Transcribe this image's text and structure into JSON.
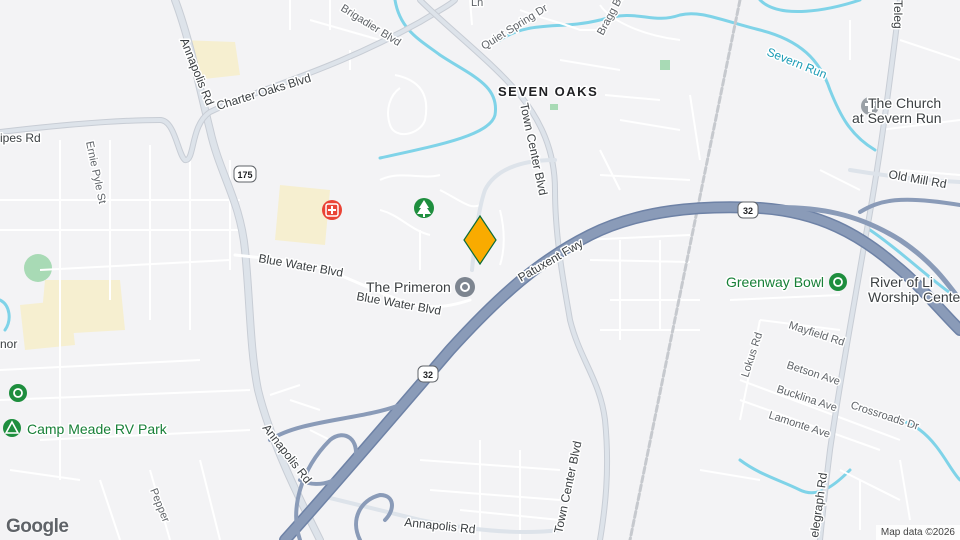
{
  "map": {
    "area_label": "SEVEN OAKS",
    "roads": {
      "brigadier": "Brigadier Blvd",
      "quiet_spring": "Quiet Spring Dr",
      "bragg": "Bragg Blvd",
      "ln": "Ln",
      "charter_oaks": "Charter Oaks Blvd",
      "annapolis_rd_top": "Annapolis Rd",
      "annapolis_rd_bottom_left": "Annapolis Rd",
      "annapolis_rd_bottom": "Annapolis Rd",
      "pipes_rd": "ipes Rd",
      "ernie_pyle": "Ernie Pyle St",
      "town_center_top": "Town Center Blvd",
      "town_center_bottom": "Town Center Blvd",
      "blue_water_left": "Blue Water Blvd",
      "blue_water_right": "Blue Water Blvd",
      "patuxent": "Patuxent Fwy",
      "old_mill": "Old Mill Rd",
      "mayfield": "Mayfield Rd",
      "lokus": "Lokus Rd",
      "betson": "Betson Ave",
      "bucklina": "Bucklina Ave",
      "lamonte": "Lamonte Ave",
      "crossroads": "Crossroads Dr",
      "telegraph_top": "Teleg",
      "telegraph_bottom": "elegraph Rd",
      "pepper": "Pepper",
      "nor": "nor"
    },
    "water": {
      "severn_run": "Severn Run"
    },
    "shields": {
      "md175": "175",
      "md32_a": "32",
      "md32_b": "32"
    },
    "pois": {
      "church_line1": "The Church",
      "church_line2": "at Severn Run",
      "greenway": "Greenway Bowl",
      "river_line1": "River of Li",
      "river_line2": "Worship Cente",
      "primeron": "The Primeron",
      "camp_meade": "Camp Meade RV Park"
    },
    "marker_color": "#f9ab00",
    "colors": {
      "freeway": "#8a9bb8",
      "water": "#7fd3e8",
      "park": "#a8dab5",
      "urban": "#f6efd0"
    }
  },
  "logo": "Google",
  "attribution": "Map data ©2026"
}
